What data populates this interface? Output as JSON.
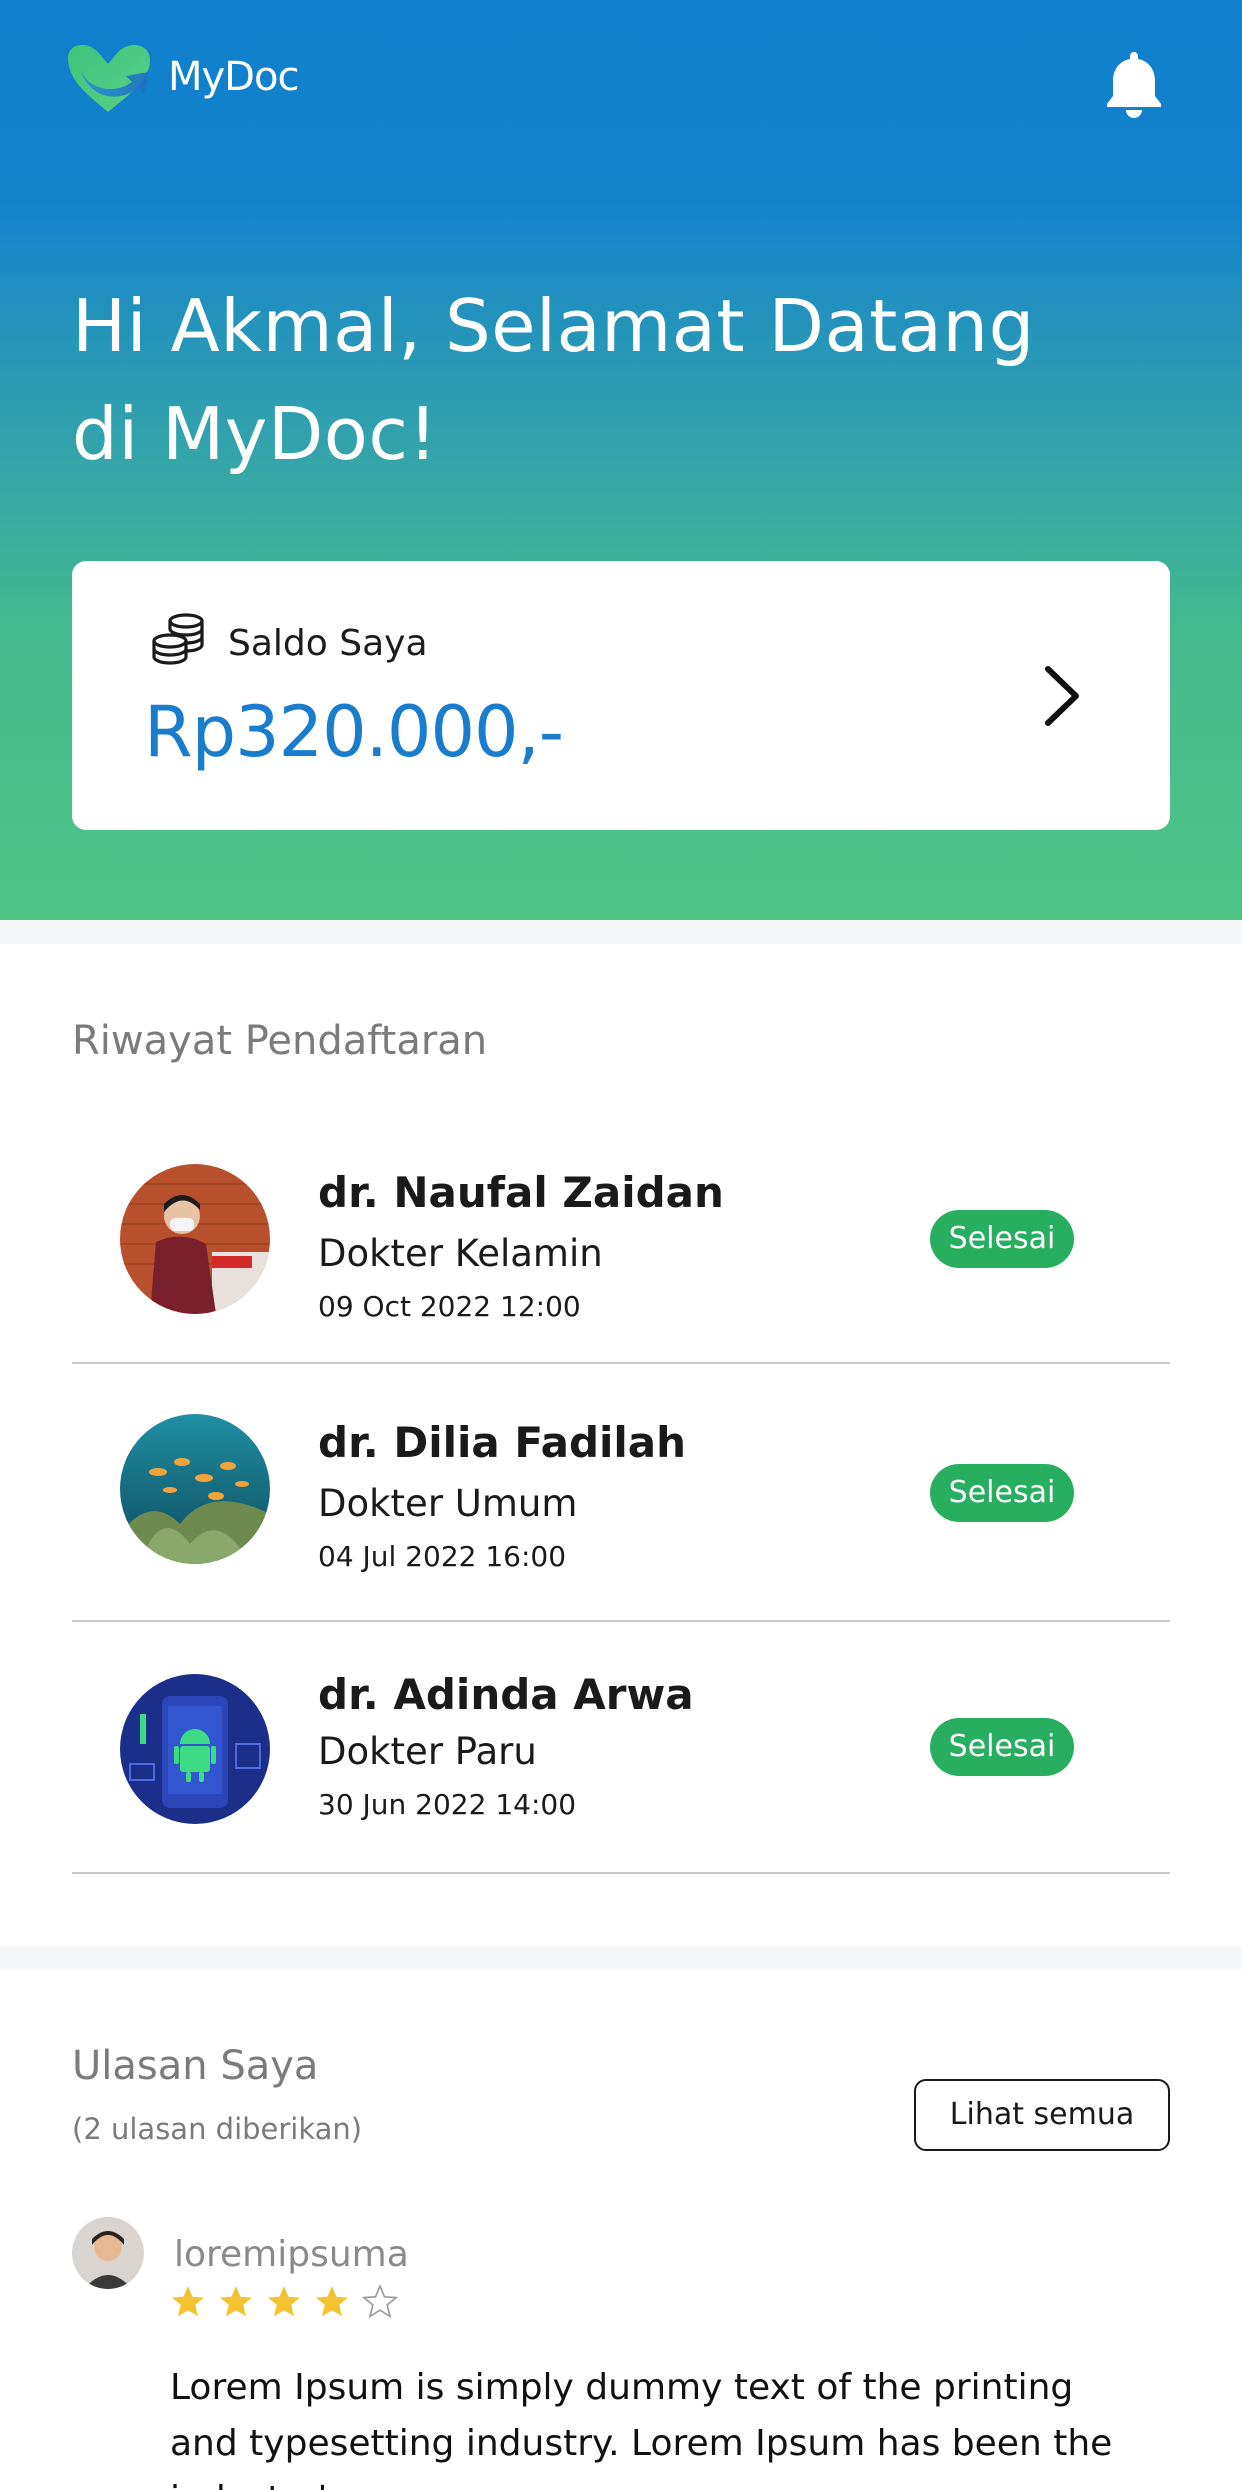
{
  "header": {
    "brand_name": "MyDoc",
    "greeting_line1": "Hi Akmal, Selamat Datang",
    "greeting_line2": "di MyDoc!"
  },
  "balance": {
    "label": "Saldo Saya",
    "value": "Rp320.000,-"
  },
  "history": {
    "title": "Riwayat Pendaftaran",
    "items": [
      {
        "name": "dr. Naufal Zaidan",
        "specialty": "Dokter Kelamin",
        "datetime": "09 Oct 2022 12:00",
        "status": "Selesai"
      },
      {
        "name": "dr. Dilia Fadilah",
        "specialty": "Dokter Umum",
        "datetime": "04 Jul 2022 16:00",
        "status": "Selesai"
      },
      {
        "name": "dr. Adinda Arwa",
        "specialty": "Dokter Paru",
        "datetime": "30 Jun 2022 14:00",
        "status": "Selesai"
      }
    ]
  },
  "reviews": {
    "title": "Ulasan Saya",
    "count_text": "(2 ulasan diberikan)",
    "see_all_label": "Lihat semua",
    "items": [
      {
        "username": "loremipsuma",
        "rating": 4,
        "max_rating": 5,
        "text": "Lorem Ipsum is simply dummy text of the printing and typesetting industry. Lorem Ipsum has been the industry's"
      }
    ]
  },
  "colors": {
    "primary_blue": "#1a7ccd",
    "gradient_top": "#0f7fce",
    "gradient_bottom": "#4fc588",
    "status_green": "#27ae5f",
    "star_gold": "#f2c230"
  },
  "icons": {
    "logo": "mydoc-logo-icon",
    "notification": "bell-icon",
    "balance": "coins-icon",
    "balance_action": "chevron-right-icon",
    "rating": "star-icon"
  }
}
